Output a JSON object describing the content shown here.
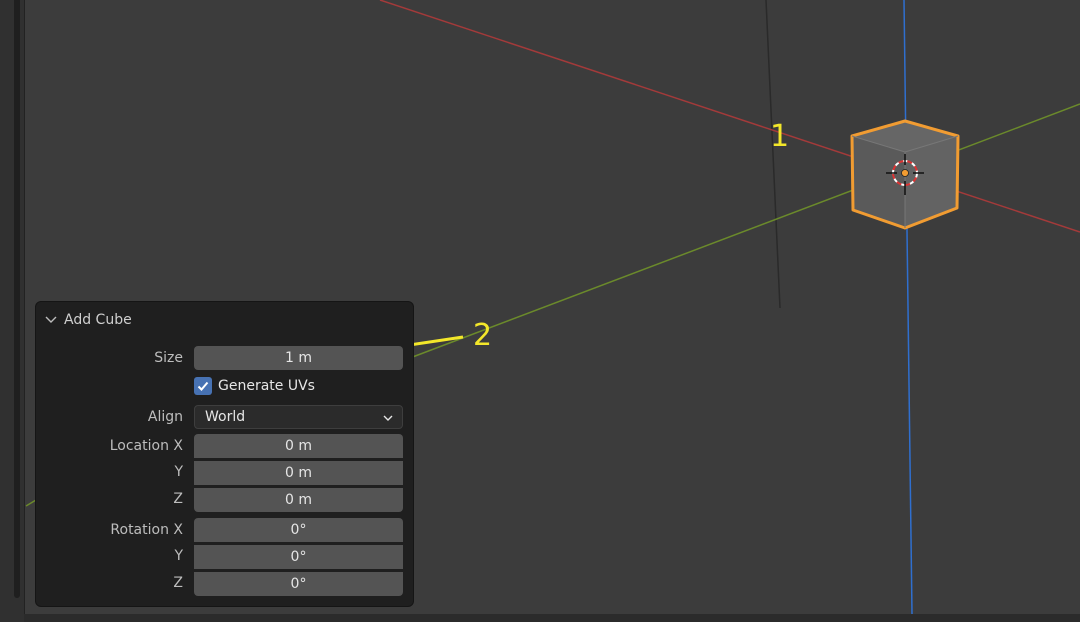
{
  "annotations": {
    "marker_one": "1",
    "marker_two": "2"
  },
  "colors": {
    "viewport_bg": "#3c3c3c",
    "x_axis": "#a33a3a",
    "y_axis": "#6b8a2b",
    "z_axis": "#2f6fcf",
    "selection": "#f19c32",
    "annotation": "#f3e72a",
    "checkbox": "#4772b3"
  },
  "icons": {
    "collapse": "chevron-down-icon",
    "checkbox": "checkmark-icon",
    "dropdown": "chevron-down-icon",
    "cursor": "3d-cursor-icon"
  },
  "panel": {
    "title": "Add Cube",
    "size": {
      "label": "Size",
      "value": "1 m"
    },
    "generate_uvs": {
      "label": "Generate UVs",
      "checked": true
    },
    "align": {
      "label": "Align",
      "value": "World"
    },
    "location": {
      "x_label": "Location X",
      "x_value": "0 m",
      "y_label": "Y",
      "y_value": "0 m",
      "z_label": "Z",
      "z_value": "0 m"
    },
    "rotation": {
      "x_label": "Rotation X",
      "x_value": "0°",
      "y_label": "Y",
      "y_value": "0°",
      "z_label": "Z",
      "z_value": "0°"
    }
  }
}
